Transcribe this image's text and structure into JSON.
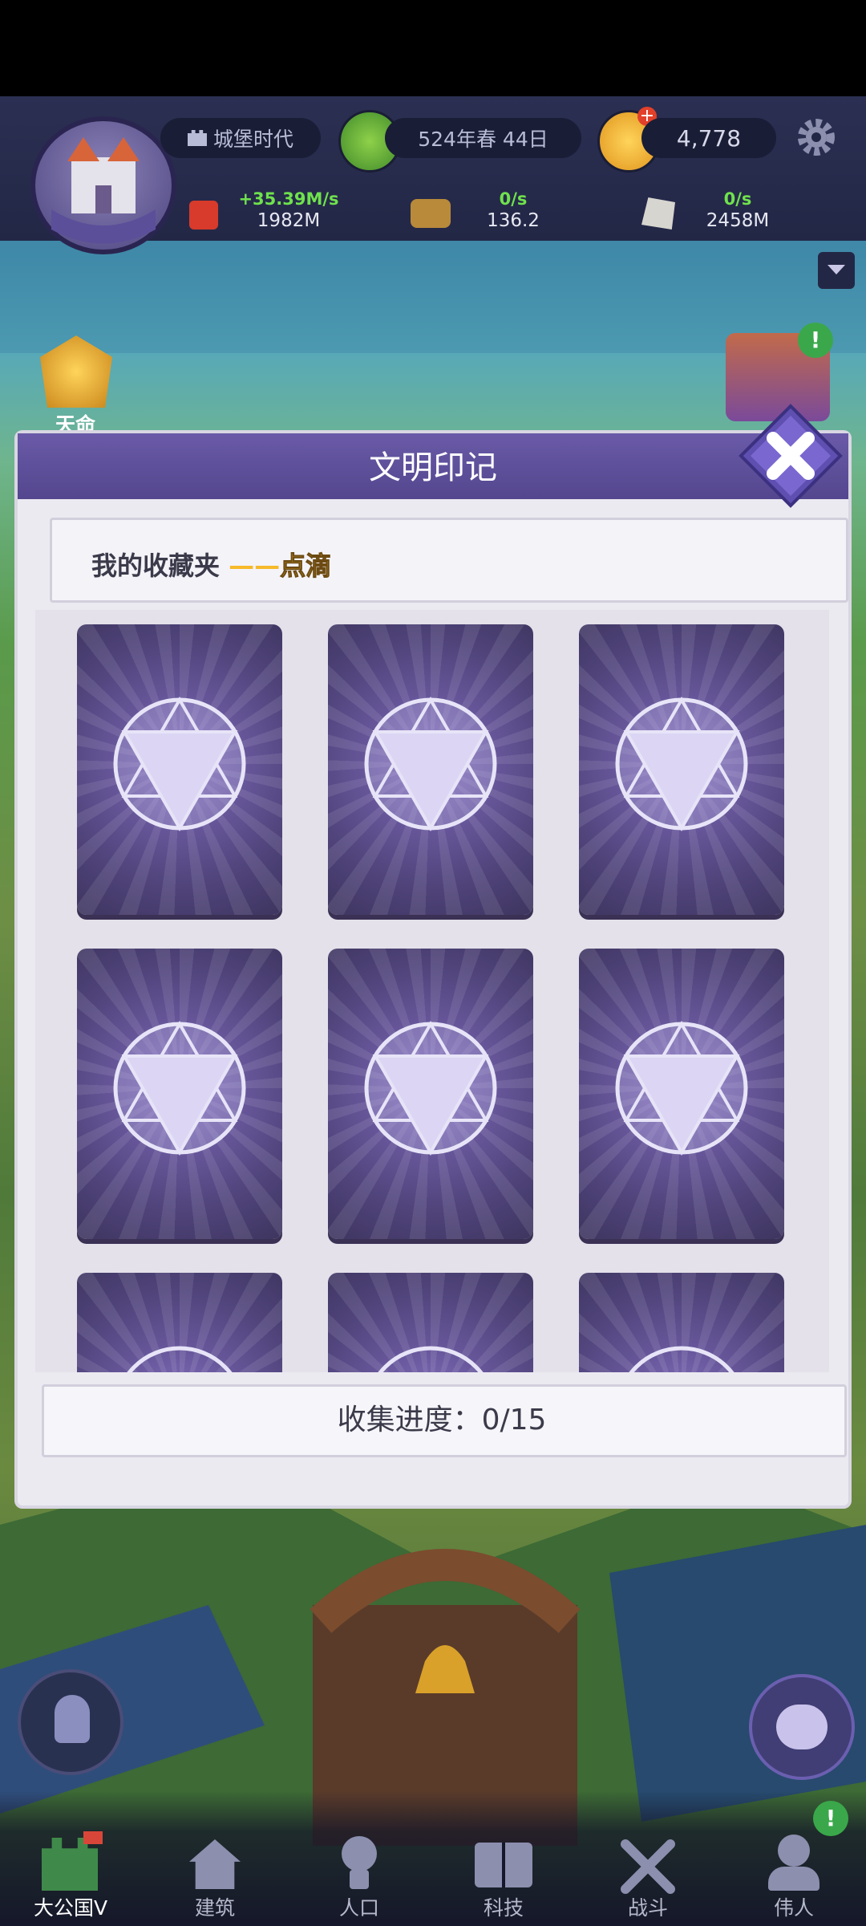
{
  "header": {
    "era": "城堡时代",
    "date": "524年春 44日",
    "coins": "4,778"
  },
  "resources": [
    {
      "rate": "+35.39M/s",
      "value": "1982M"
    },
    {
      "rate": "0/s",
      "value": "136.2"
    },
    {
      "rate": "0/s",
      "value": "2458M"
    }
  ],
  "side": {
    "destiny_label": "天命"
  },
  "dialog": {
    "title": "文明印记",
    "ribbon_prefix": "我的收藏夹",
    "ribbon_sep": "——",
    "ribbon_highlight": "点滴",
    "progress": "收集进度：0/15"
  },
  "cards": {
    "visible_count": 9,
    "total": 15,
    "collected": 0
  },
  "nav": [
    {
      "label": "大公国V",
      "icon": "castle-icon",
      "active": true
    },
    {
      "label": "建筑",
      "icon": "house-icon",
      "active": false
    },
    {
      "label": "人口",
      "icon": "person-icon",
      "active": false
    },
    {
      "label": "科技",
      "icon": "book-icon",
      "active": false
    },
    {
      "label": "战斗",
      "icon": "swords-icon",
      "active": false
    },
    {
      "label": "伟人",
      "icon": "bust-icon",
      "active": false
    }
  ],
  "colors": {
    "accent_purple": "#54468e",
    "highlight_gold": "#f6b92a",
    "rate_green": "#6fe24d"
  }
}
